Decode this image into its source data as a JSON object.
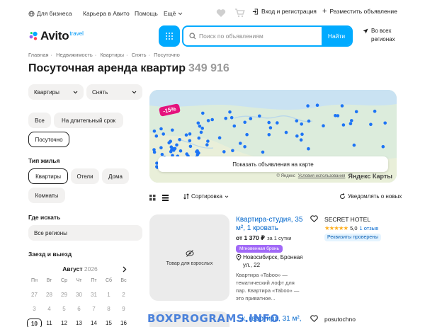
{
  "topbar": {
    "business": "Для бизнеса",
    "career": "Карьера в Авито",
    "help": "Помощь",
    "more": "Ещё",
    "login": "Вход и регистрация",
    "post_ad": "Разместить объявление"
  },
  "logo": {
    "name": "Avito",
    "sub": "travel"
  },
  "search": {
    "placeholder": "Поиск по объявлениям",
    "button": "Найти"
  },
  "region": {
    "line1": "Во всех",
    "line2": "регионах"
  },
  "breadcrumbs": [
    "Главная",
    "Недвижимость",
    "Квартиры",
    "Снять",
    "Посуточно"
  ],
  "page": {
    "title": "Посуточная аренда квартир",
    "count": "349 916"
  },
  "filters": {
    "category": "Квартиры",
    "deal": "Снять",
    "term_options": [
      "Все",
      "На длительный срок",
      "Посуточно"
    ],
    "housing_label": "Тип жилья",
    "housing_options": [
      "Квартиры",
      "Отели",
      "Дома",
      "Комнаты"
    ],
    "where_label": "Где искать",
    "where_value": "Все регионы",
    "dates_label": "Заезд и выезд"
  },
  "calendar": {
    "month": "Август",
    "year": "2026",
    "weekdays": [
      "Пн",
      "Вт",
      "Ср",
      "Чт",
      "Пт",
      "Сб",
      "Вс"
    ],
    "row1": [
      "27",
      "28",
      "29",
      "30",
      "31",
      "1",
      "2"
    ],
    "row2": [
      "3",
      "4",
      "5",
      "6",
      "7",
      "8",
      "9"
    ],
    "row3": [
      "10",
      "11",
      "12",
      "13",
      "14",
      "15",
      "16"
    ]
  },
  "map": {
    "discount": "-15%",
    "show_button": "Показать объявления на карте",
    "attribution": "© Яндекс",
    "terms": "Условия использования",
    "brand": "Яндекс Карты"
  },
  "toolbar": {
    "sort": "Сортировка",
    "notify": "Уведомлять о новых"
  },
  "listing1": {
    "thumb_text": "Товар для взрослых",
    "title": "Квартира-студия, 35 м², 1 кровать",
    "price": "от 1 370 ₽",
    "price_unit": "за 1 сутки",
    "instant": "Мгновенная бронь",
    "address": "Новосибирск, Бронная ул., 22",
    "description": "Квартира «Taboo» — тематический лофт для пар. Квартира «Taboo» — это приватное...",
    "seller": "SECRET HOTEL",
    "stars": "★★★★★",
    "rating": "5,0",
    "reviews": "1 отзыв",
    "verified": "Реквизиты проверены"
  },
  "listing2": {
    "title": "...к, квартира, 31 м²,",
    "seller": "posutochno"
  },
  "watermark": "BOXPROGRAMS.INFO",
  "colors": {
    "accent": "#00aaff",
    "link": "#0066cc",
    "instant": "#a169f7",
    "promo": "#e5127d",
    "star": "#ffb021"
  }
}
